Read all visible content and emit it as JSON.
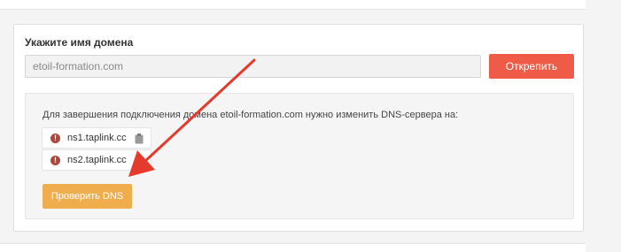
{
  "domain": {
    "label": "Укажите имя домена",
    "value": "etoil-formation.com",
    "detach_label": "Открепить"
  },
  "dns": {
    "instruction": "Для завершения подключения домена etoil-formation.com нужно изменить DNS-сервера на:",
    "servers": [
      {
        "name": "ns1.taplink.cc",
        "status_icon": "warning-icon",
        "action_icon": "clipboard-icon"
      },
      {
        "name": "ns2.taplink.cc",
        "status_icon": "warning-icon",
        "action_icon": "clipboard-icon"
      }
    ],
    "check_label": "Проверить DNS"
  },
  "colors": {
    "detach_button": "#ef5b47",
    "check_button": "#f0ad4e",
    "warning": "#b34437",
    "arrow": "#e53b2c"
  }
}
